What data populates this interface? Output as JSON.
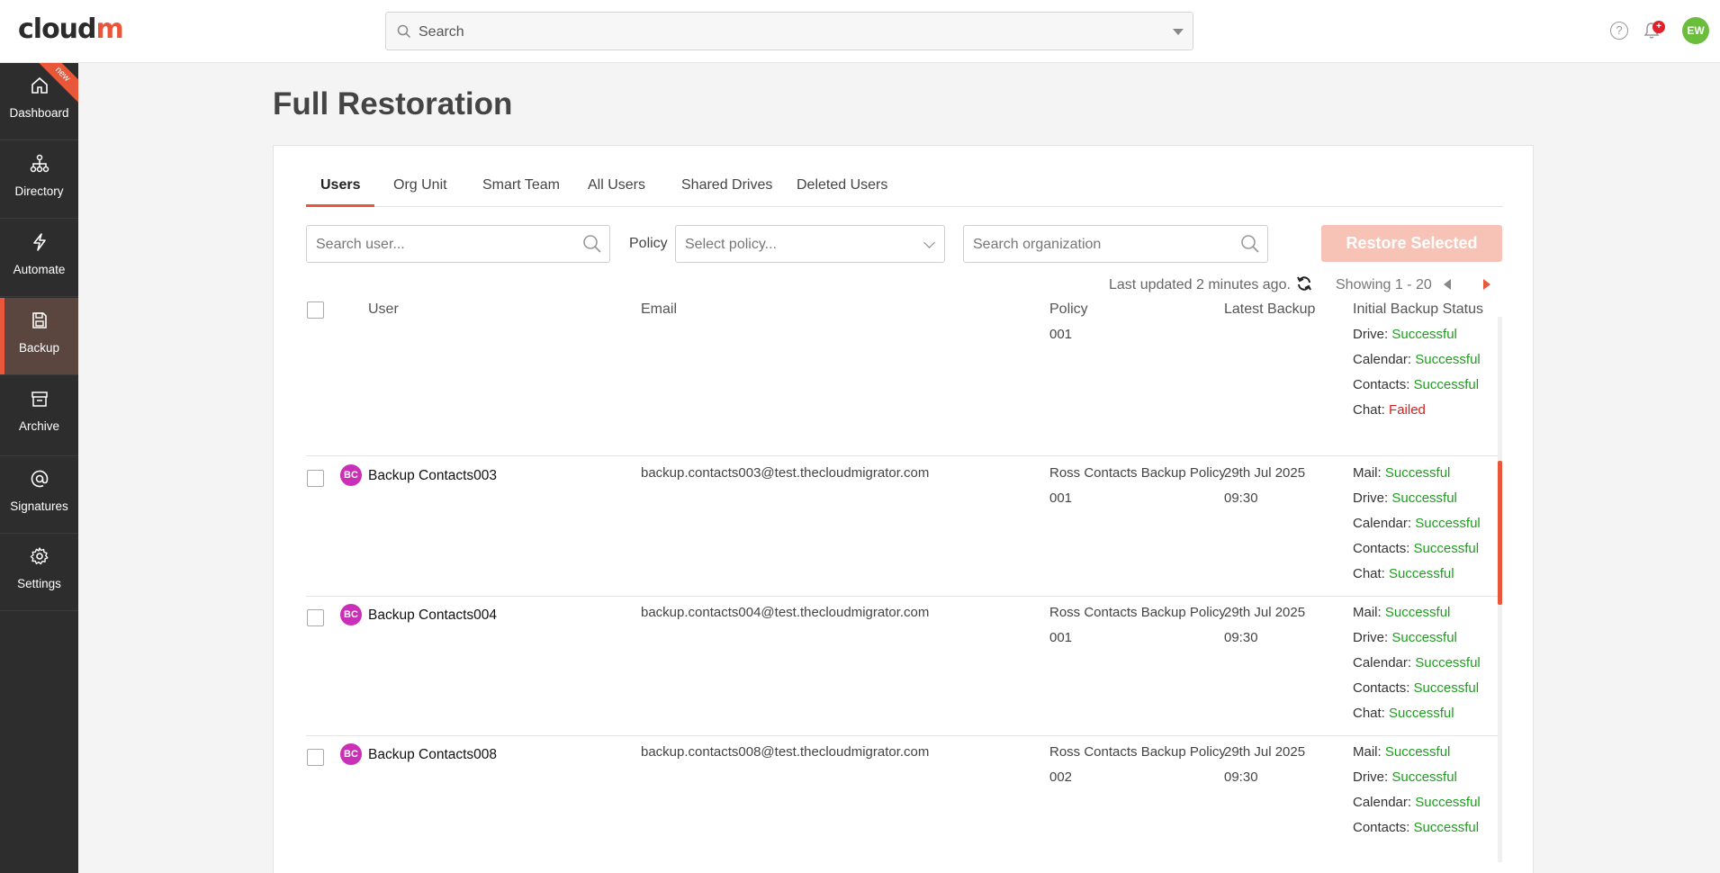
{
  "app": {
    "logo_text": "cloud",
    "logo_accent": "m",
    "search_placeholder": "Search",
    "avatar_initials": "EW",
    "notification_count": "+"
  },
  "sidebar": {
    "items": [
      {
        "label": "Dashboard",
        "icon": "home-icon",
        "badge": "new"
      },
      {
        "label": "Directory",
        "icon": "hierarchy-icon"
      },
      {
        "label": "Automate",
        "icon": "lightning-icon"
      },
      {
        "label": "Backup",
        "icon": "save-icon",
        "active": true
      },
      {
        "label": "Archive",
        "icon": "archive-box-icon"
      },
      {
        "label": "Signatures",
        "icon": "at-sign-icon"
      },
      {
        "label": "Settings",
        "icon": "gear-icon"
      }
    ]
  },
  "page": {
    "title": "Full Restoration"
  },
  "tabs": [
    "Users",
    "Org Unit",
    "Smart Team",
    "All Users",
    "Shared Drives",
    "Deleted Users"
  ],
  "filters": {
    "search_user_placeholder": "Search user...",
    "policy_label": "Policy",
    "policy_placeholder": "Select policy...",
    "search_org_placeholder": "Search organization",
    "restore_button": "Restore Selected"
  },
  "status_bar": {
    "last_updated": "Last updated 2 minutes ago.",
    "showing": "Showing 1 - 20"
  },
  "table": {
    "headers": {
      "user": "User",
      "email": "Email",
      "policy": "Policy",
      "latest_backup": "Latest Backup",
      "initial_status": "Initial Backup Status"
    },
    "partial_row": {
      "policy": "001",
      "statuses": [
        {
          "k": "Drive: ",
          "v": "Successful"
        },
        {
          "k": "Calendar: ",
          "v": "Successful"
        },
        {
          "k": "Contacts: ",
          "v": "Successful"
        },
        {
          "k": "Chat: ",
          "v": "Failed"
        }
      ]
    },
    "rows": [
      {
        "initials": "BC",
        "name": "Backup Contacts003",
        "email": "backup.contacts003@test.thecloudmigrator.com",
        "policy_line1": "Ross Contacts Backup Policy",
        "policy_line2": "001",
        "backup_date": "29th Jul 2025",
        "backup_time": "09:30",
        "statuses": [
          {
            "k": "Mail: ",
            "v": "Successful"
          },
          {
            "k": "Drive: ",
            "v": "Successful"
          },
          {
            "k": "Calendar: ",
            "v": "Successful"
          },
          {
            "k": "Contacts: ",
            "v": "Successful"
          },
          {
            "k": "Chat: ",
            "v": "Successful"
          }
        ]
      },
      {
        "initials": "BC",
        "name": "Backup Contacts004",
        "email": "backup.contacts004@test.thecloudmigrator.com",
        "policy_line1": "Ross Contacts Backup Policy",
        "policy_line2": "001",
        "backup_date": "29th Jul 2025",
        "backup_time": "09:30",
        "statuses": [
          {
            "k": "Mail: ",
            "v": "Successful"
          },
          {
            "k": "Drive: ",
            "v": "Successful"
          },
          {
            "k": "Calendar: ",
            "v": "Successful"
          },
          {
            "k": "Contacts: ",
            "v": "Successful"
          },
          {
            "k": "Chat: ",
            "v": "Successful"
          }
        ]
      },
      {
        "initials": "BC",
        "name": "Backup Contacts008",
        "email": "backup.contacts008@test.thecloudmigrator.com",
        "policy_line1": "Ross Contacts Backup Policy",
        "policy_line2": "002",
        "backup_date": "29th Jul 2025",
        "backup_time": "09:30",
        "statuses": [
          {
            "k": "Mail: ",
            "v": "Successful"
          },
          {
            "k": "Drive: ",
            "v": "Successful"
          },
          {
            "k": "Calendar: ",
            "v": "Successful"
          },
          {
            "k": "Contacts: ",
            "v": "Successful"
          }
        ]
      }
    ]
  },
  "colors": {
    "accent": "#e8573a",
    "success": "#1f9d1f",
    "failed": "#d42020",
    "sidebar": "#2d2d2d",
    "avatar_user": "#6bbd3e",
    "avatar_row": "#c92fb7"
  }
}
